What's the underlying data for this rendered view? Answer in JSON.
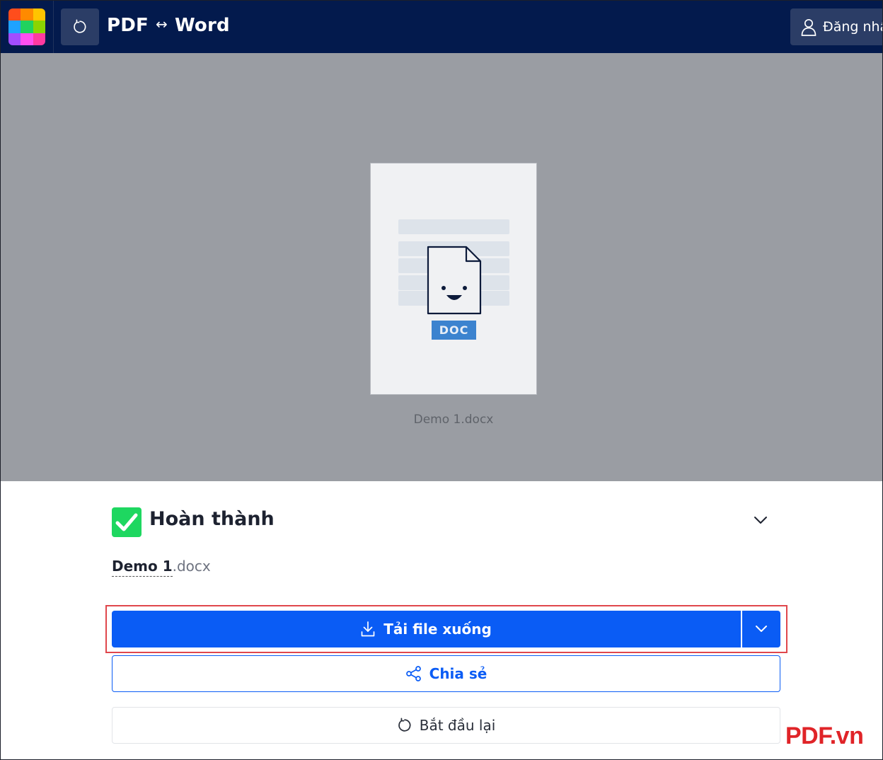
{
  "header": {
    "logo_colors": [
      "#ff4d1c",
      "#ff8a00",
      "#ffc400",
      "#1fa2ff",
      "#21d25e",
      "#8bd400",
      "#a24dff",
      "#ff4ff0",
      "#ff3aa0"
    ],
    "title_left": "PDF",
    "title_arrow": "↔",
    "title_right": "Word",
    "login_label": "Đăng nhập"
  },
  "preview": {
    "doc_badge": "DOC",
    "file_caption": "Demo 1.docx"
  },
  "panel": {
    "status_title": "Hoàn thành",
    "filename_base": "Demo 1",
    "filename_ext": ".docx",
    "download_label": "Tải file xuống",
    "share_label": "Chia sẻ",
    "restart_label": "Bắt đầu lại"
  },
  "watermark": "PDF.vn",
  "colors": {
    "header_bg": "#031a4d",
    "primary": "#0a5cf5",
    "success": "#1ed760",
    "highlight": "#e0474c",
    "watermark": "#e02428"
  }
}
